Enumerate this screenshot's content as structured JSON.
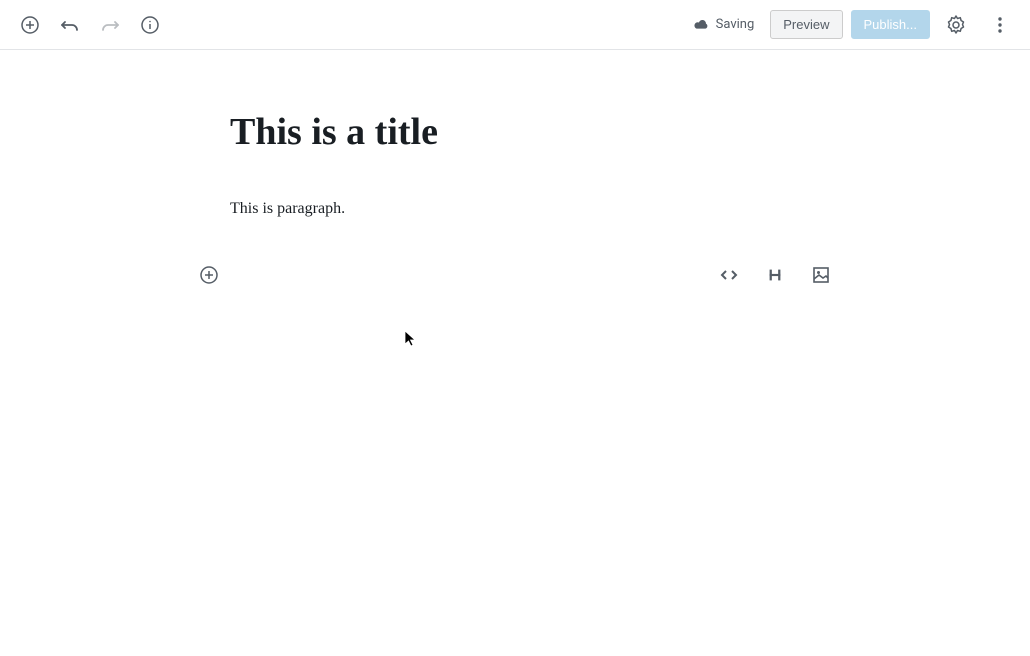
{
  "toolbar": {
    "saving_label": "Saving",
    "preview_label": "Preview",
    "publish_label": "Publish..."
  },
  "editor": {
    "title": "This is a title",
    "paragraph": "This is paragraph."
  }
}
